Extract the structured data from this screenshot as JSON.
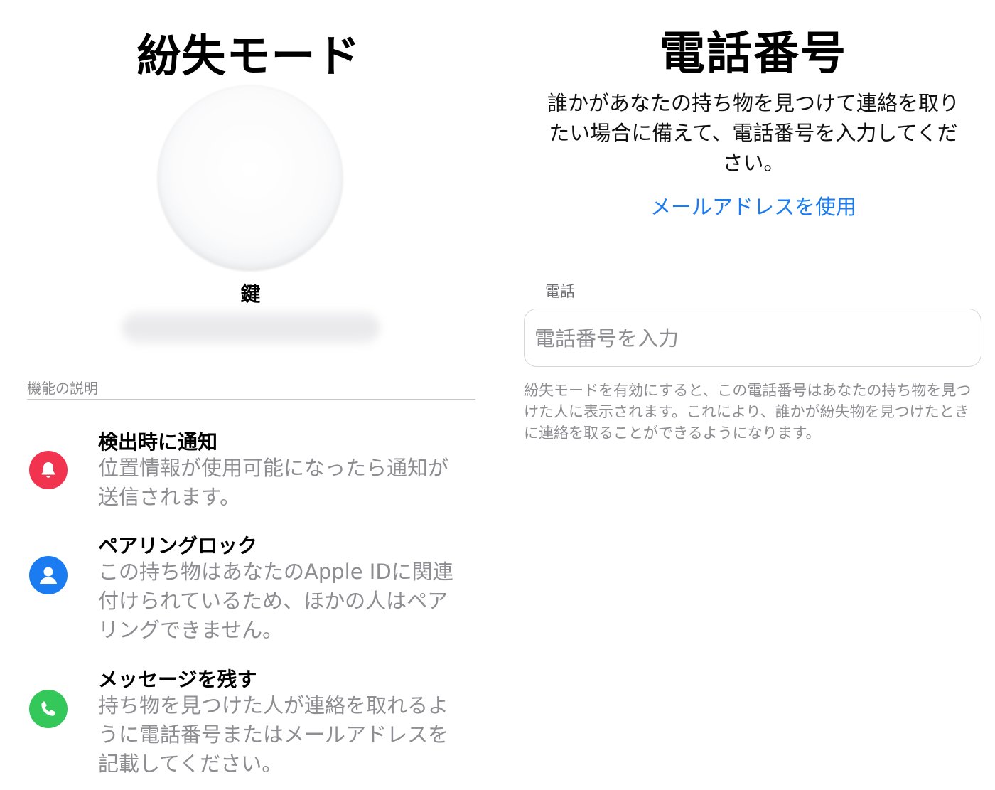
{
  "left": {
    "title": "紛失モード",
    "item_name": "鍵",
    "section_label": "機能の説明",
    "features": [
      {
        "icon": "bell-icon",
        "icon_color": "#f2334f",
        "title": "検出時に通知",
        "desc": "位置情報が使用可能になったら通知が送信されます。"
      },
      {
        "icon": "person-icon",
        "icon_color": "#1a7cf0",
        "title": "ペアリングロック",
        "desc": "この持ち物はあなたのApple IDに関連付けられているため、ほかの人はペアリングできません。"
      },
      {
        "icon": "phone-icon",
        "icon_color": "#34c759",
        "title": "メッセージを残す",
        "desc": "持ち物を見つけた人が連絡を取れるように電話番号またはメールアドレスを記載してください。"
      }
    ]
  },
  "right": {
    "title": "電話番号",
    "description": "誰かがあなたの持ち物を見つけて連絡を取りたい場合に備えて、電話番号を入力してください。",
    "email_link": "メールアドレスを使用",
    "link_color": "#1a7cf0",
    "phone_label": "電話",
    "phone_value": "",
    "phone_placeholder": "電話番号を入力",
    "note": "紛失モードを有効にすると、この電話番号はあなたの持ち物を見つけた人に表示されます。これにより、誰かが紛失物を見つけたときに連絡を取ることができるようになります。"
  }
}
